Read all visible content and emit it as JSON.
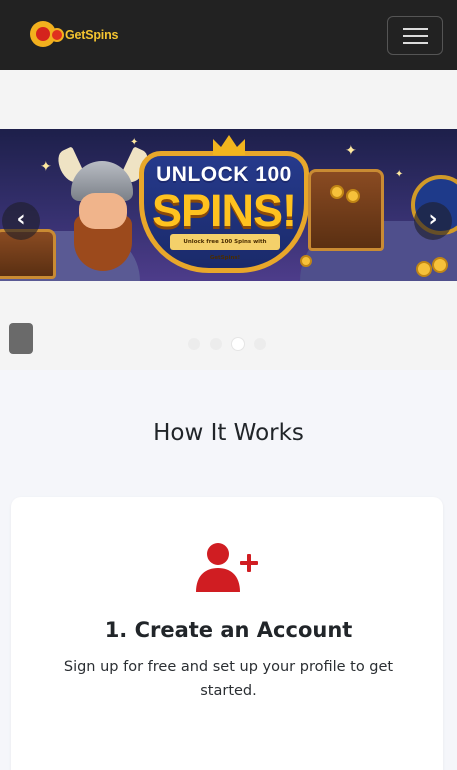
{
  "navbar": {
    "brand_text": "GetSpins",
    "menu_icon": "hamburger-menu-icon"
  },
  "carousel": {
    "slide": {
      "headline_top": "UNLOCK 100",
      "headline_main": "SPINS!",
      "ribbon_text": "Unlock free 100 Spins with GetSpins!"
    },
    "prev_icon": "chevron-left-icon",
    "next_icon": "chevron-right-icon",
    "indicators": 4,
    "active_indicator": 3
  },
  "how_it_works": {
    "title": "How It Works",
    "steps": [
      {
        "icon": "user-plus-icon",
        "title": "1. Create an Account",
        "description": "Sign up for free and set up your profile to get started."
      }
    ]
  },
  "colors": {
    "navbar_bg": "#222222",
    "brand_yellow": "#f4c430",
    "accent_red": "#d01d22",
    "page_bg": "#f5f6fa"
  }
}
